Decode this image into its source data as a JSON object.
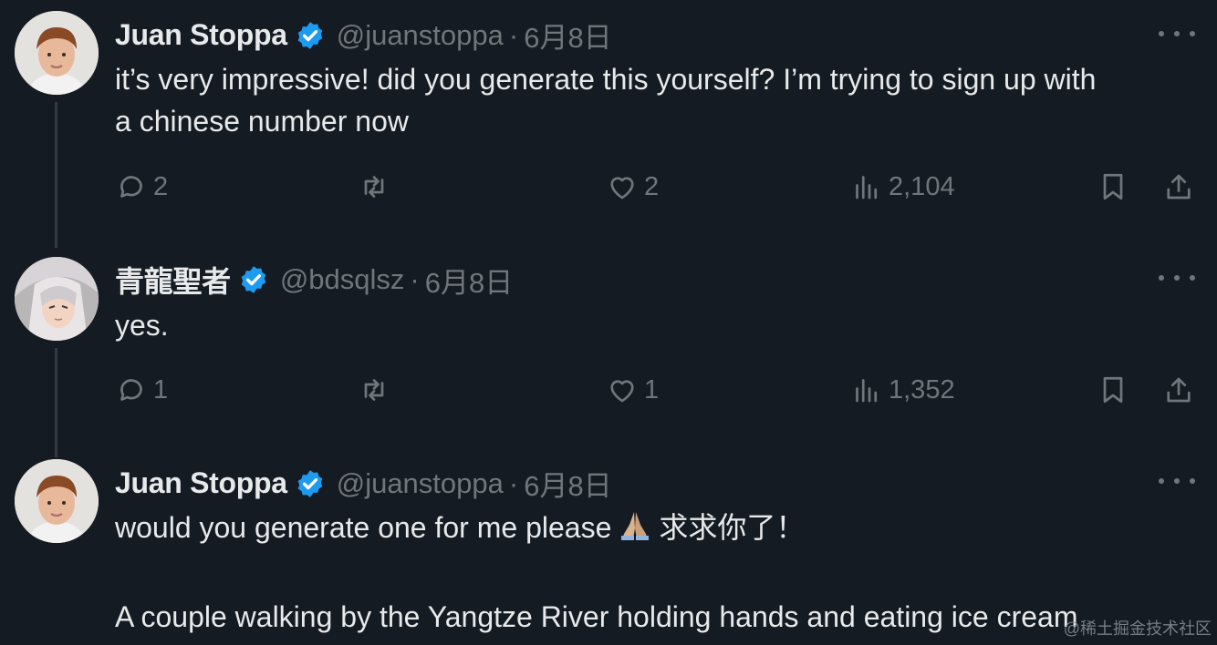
{
  "tweets": [
    {
      "name": "Juan Stoppa",
      "handle": "@juanstoppa",
      "sep": "·",
      "date": "6月8日",
      "text_lines": [
        "it’s very impressive! did you generate this yourself? I’m trying to sign up with",
        "a chinese number now"
      ],
      "replies": "2",
      "likes": "2",
      "views": "2,104"
    },
    {
      "name": "青龍聖者",
      "handle": "@bdsqlsz",
      "sep": "·",
      "date": "6月8日",
      "text_lines": [
        "yes."
      ],
      "replies": "1",
      "likes": "1",
      "views": "1,352"
    },
    {
      "name": "Juan Stoppa",
      "handle": "@juanstoppa",
      "sep": "·",
      "date": "6月8日",
      "text_a": "would you generate one for me please",
      "text_b": "求求你了！",
      "text_c": "A couple walking by the Yangtze River holding hands and eating ice cream"
    }
  ],
  "watermark": "@稀土掘金技术社区",
  "colors": {
    "background": "#151b23",
    "text": "#e7e9ea",
    "muted": "#71767b",
    "verified": "#1d9bf0"
  }
}
